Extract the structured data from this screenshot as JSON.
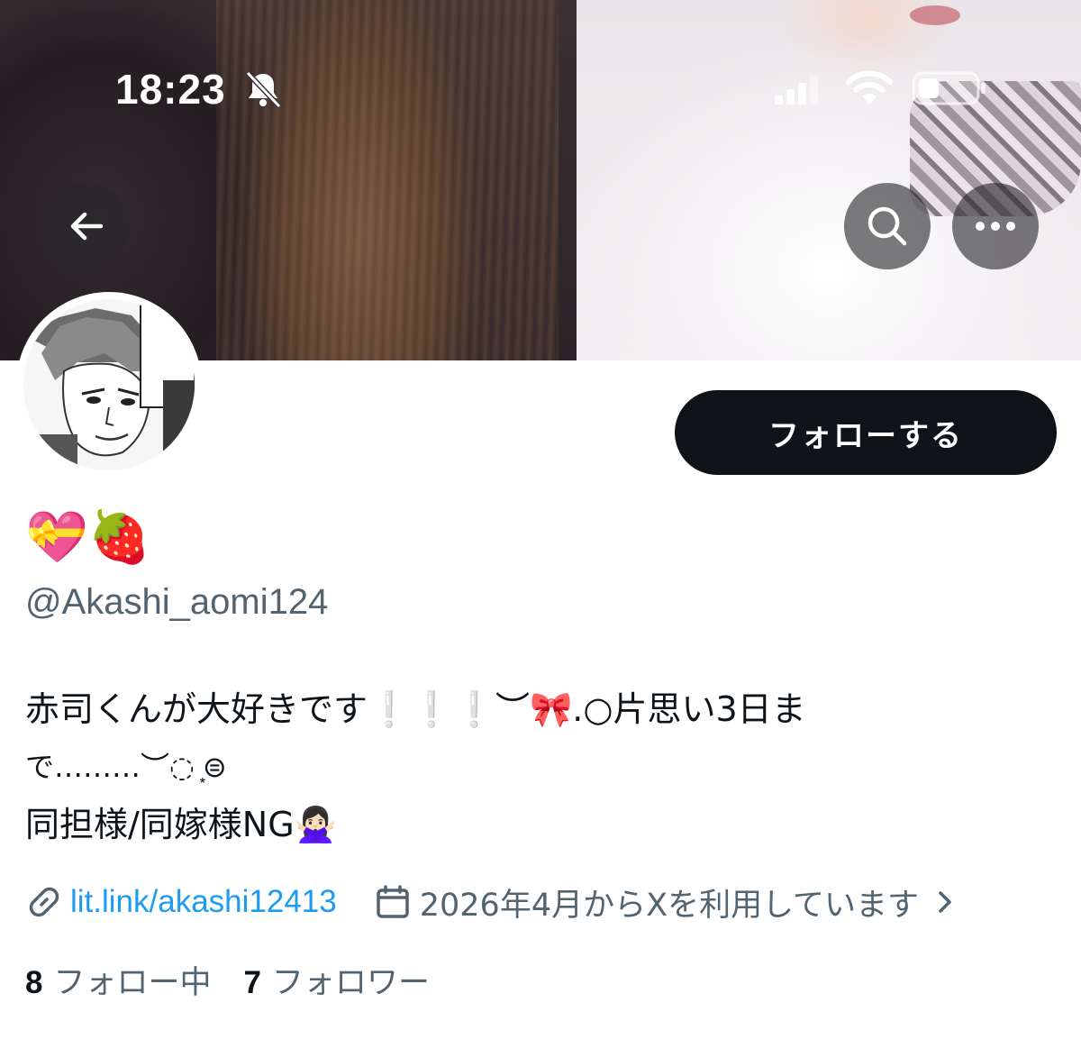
{
  "status_bar": {
    "time": "18:23"
  },
  "header": {
    "banner_icons": [
      "back-arrow-icon",
      "search-icon",
      "more-icon"
    ]
  },
  "profile": {
    "display_name": "💝🍓",
    "handle": "@Akashi_aomi124",
    "bio_lines": [
      "赤司くんが大好きです❕❕❕︶🎀.○片思い3日ま",
      "で………︶◌ ͙⊜",
      "同担様/同嫁様NG🙅🏻‍♀️"
    ],
    "link": "lit.link/akashi12413",
    "joined": "2026年4月からXを利用しています",
    "following_count": "8",
    "following_label": "フォロー中",
    "followers_count": "7",
    "followers_label": "フォロワー"
  },
  "actions": {
    "follow_label": "フォローする"
  },
  "colors": {
    "primary_text": "#0f1419",
    "secondary_text": "#536471",
    "link": "#1d9bf0",
    "button_bg": "#0f1419"
  }
}
